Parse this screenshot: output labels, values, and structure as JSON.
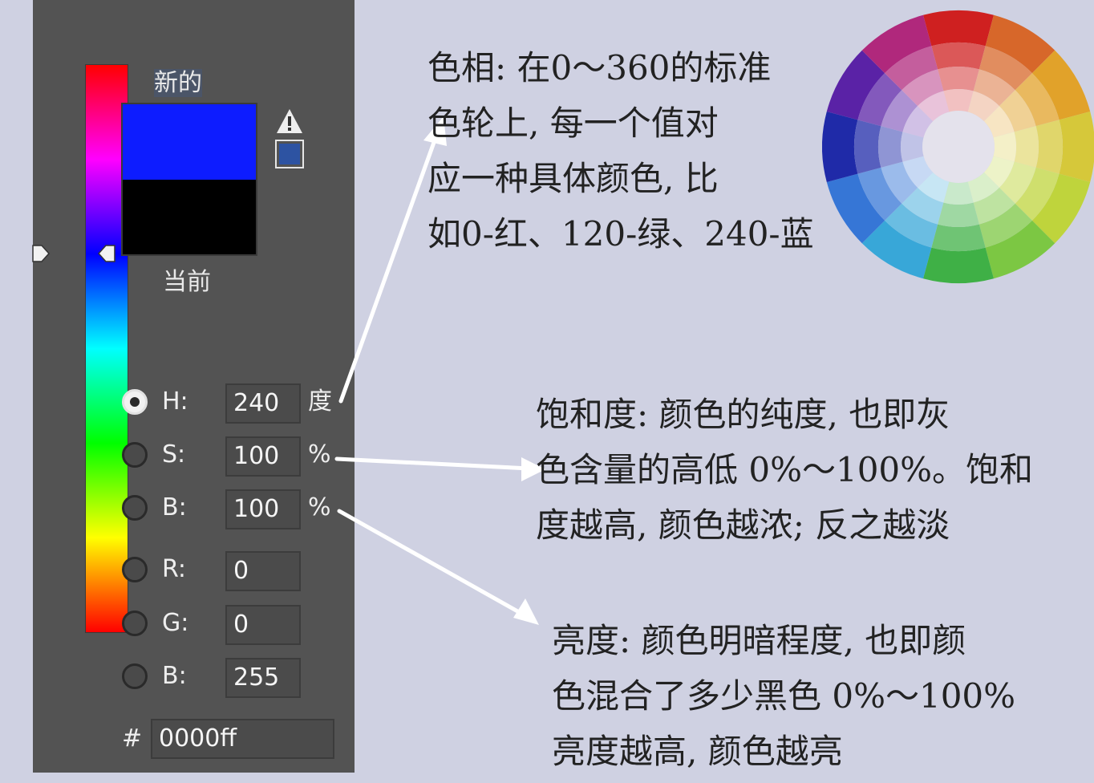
{
  "picker": {
    "new_label": "新的",
    "current_label": "当前",
    "new_color": "#0d1cff",
    "current_color": "#000000",
    "websafe_color": "#2d53a2",
    "warning_icon": "warning-triangle-icon",
    "hue_slider_value": 240,
    "fields": [
      {
        "key": "h",
        "label": "H:",
        "value": "240",
        "unit": "度",
        "checked": true
      },
      {
        "key": "s",
        "label": "S:",
        "value": "100",
        "unit": "%",
        "checked": false
      },
      {
        "key": "b",
        "label": "B:",
        "value": "100",
        "unit": "%",
        "checked": false
      },
      {
        "key": "r",
        "label": "R:",
        "value": "0",
        "unit": "",
        "checked": false
      },
      {
        "key": "g",
        "label": "G:",
        "value": "0",
        "unit": "",
        "checked": false
      },
      {
        "key": "b2",
        "label": "B:",
        "value": "255",
        "unit": "",
        "checked": false
      }
    ],
    "hex_prefix": "#",
    "hex_value": "0000ff"
  },
  "notes": {
    "hue": {
      "lines": [
        "色相: 在0～360的标准",
        "色轮上, 每一个值对",
        "应一种具体颜色, 比",
        "如0-红、120-绿、240-蓝"
      ]
    },
    "saturation": {
      "lines": [
        "饱和度: 颜色的纯度, 也即灰",
        "色含量的高低 0%～100%。饱和",
        "度越高, 颜色越浓; 反之越淡"
      ]
    },
    "brightness": {
      "lines": [
        "亮度: 颜色明暗程度, 也即颜",
        "色混合了多少黑色 0%～100%",
        "亮度越高, 颜色越亮"
      ]
    }
  },
  "color_wheel": {
    "hues": [
      "#cf2020",
      "#d7672a",
      "#e1a22a",
      "#d6c83a",
      "#bfd43c",
      "#7cc743",
      "#3fb046",
      "#38a7d8",
      "#3676d6",
      "#1f2aa8",
      "#5a22a6",
      "#b0287c"
    ]
  }
}
